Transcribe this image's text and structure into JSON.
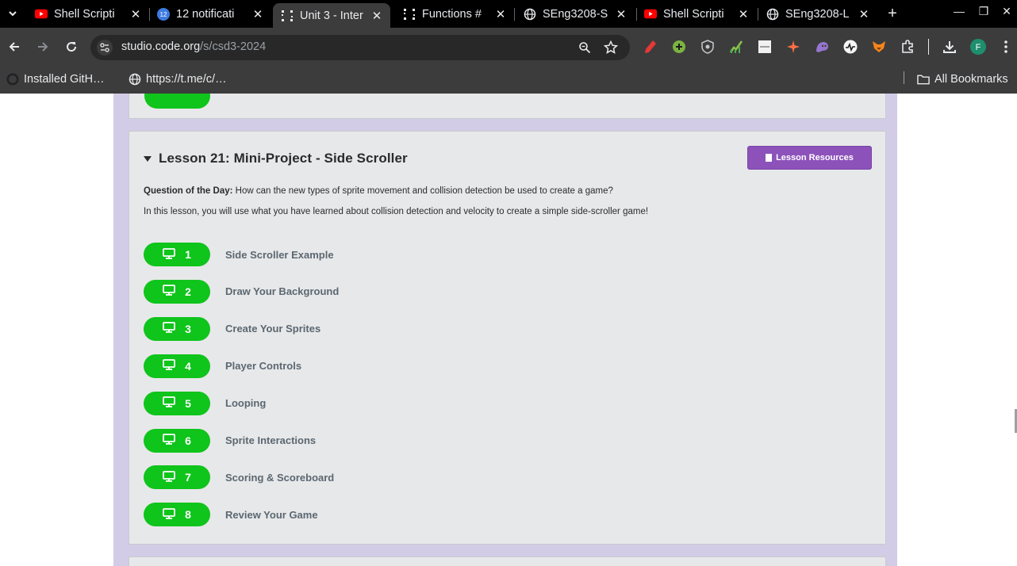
{
  "browser": {
    "tabs": [
      {
        "title": "Shell Scripti",
        "icon": "youtube-icon"
      },
      {
        "title": "12 notificati",
        "icon": "notification-badge-icon",
        "badge": "12"
      },
      {
        "title": "Unit 3 - Inter",
        "icon": "code-org-icon",
        "active": true
      },
      {
        "title": "Functions #",
        "icon": "code-org-icon"
      },
      {
        "title": "SEng3208-S",
        "icon": "globe-icon"
      },
      {
        "title": "Shell Scripti",
        "icon": "youtube-icon"
      },
      {
        "title": "SEng3208-L",
        "icon": "globe-icon"
      }
    ],
    "url_host": "studio.code.org",
    "url_path": "/s/csd3-2024",
    "bookmarks": [
      {
        "label": "Installed GitH…",
        "icon": "github-icon"
      },
      {
        "label": "https://t.me/c/…",
        "icon": "globe-icon"
      }
    ],
    "all_bookmarks": "All Bookmarks",
    "profile_initial": "F"
  },
  "lesson": {
    "title": "Lesson 21: Mini-Project - Side Scroller",
    "resources_label": "Lesson Resources",
    "qotd_label": "Question of the Day:",
    "qotd_text": " How can the new types of sprite movement and collision detection be used to create a game?",
    "intro": "In this lesson, you will use what you have learned about collision detection and velocity to create a simple side-scroller game!",
    "levels": [
      {
        "number": "1",
        "name": "Side Scroller Example"
      },
      {
        "number": "2",
        "name": "Draw Your Background"
      },
      {
        "number": "3",
        "name": "Create Your Sprites"
      },
      {
        "number": "4",
        "name": "Player Controls"
      },
      {
        "number": "5",
        "name": "Looping"
      },
      {
        "number": "6",
        "name": "Sprite Interactions"
      },
      {
        "number": "7",
        "name": "Scoring & Scoreboard"
      },
      {
        "number": "8",
        "name": "Review Your Game"
      }
    ]
  },
  "colors": {
    "level_green": "#0fc41b",
    "resources_purple": "#8c52ba",
    "unit_frame": "#d3cce6"
  }
}
